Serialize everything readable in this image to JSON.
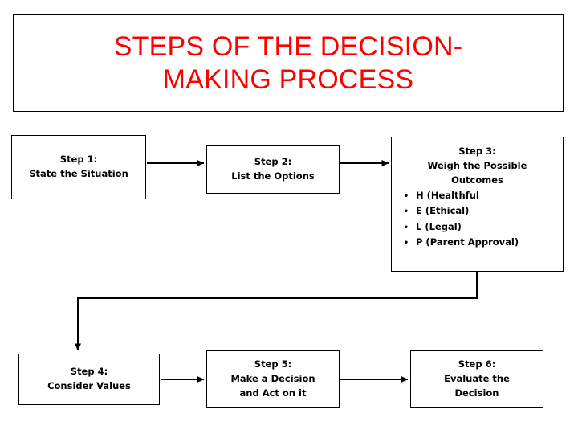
{
  "title": {
    "text": "STEPS OF THE DECISION-\nMAKING PROCESS",
    "color": "#ff0000"
  },
  "steps": [
    {
      "id": "step1",
      "text": "Step 1:\nState the Situation"
    },
    {
      "id": "step2",
      "text": "Step 2:\nList the Options"
    },
    {
      "id": "step3",
      "heading": "Step 3:\nWeigh the Possible\nOutcomes",
      "bullets": [
        "H (Healthful",
        "E (Ethical)",
        "L (Legal)",
        "P (Parent Approval)"
      ],
      "bullet_glyph": "•"
    },
    {
      "id": "step4",
      "text": "Step 4:\nConsider Values"
    },
    {
      "id": "step5",
      "text": "Step 5:\nMake a Decision\nand Act on it"
    },
    {
      "id": "step6",
      "text": "Step 6:\nEvaluate the\nDecision"
    }
  ],
  "connectors": {
    "arrow_color": "#000000",
    "count": 5
  }
}
